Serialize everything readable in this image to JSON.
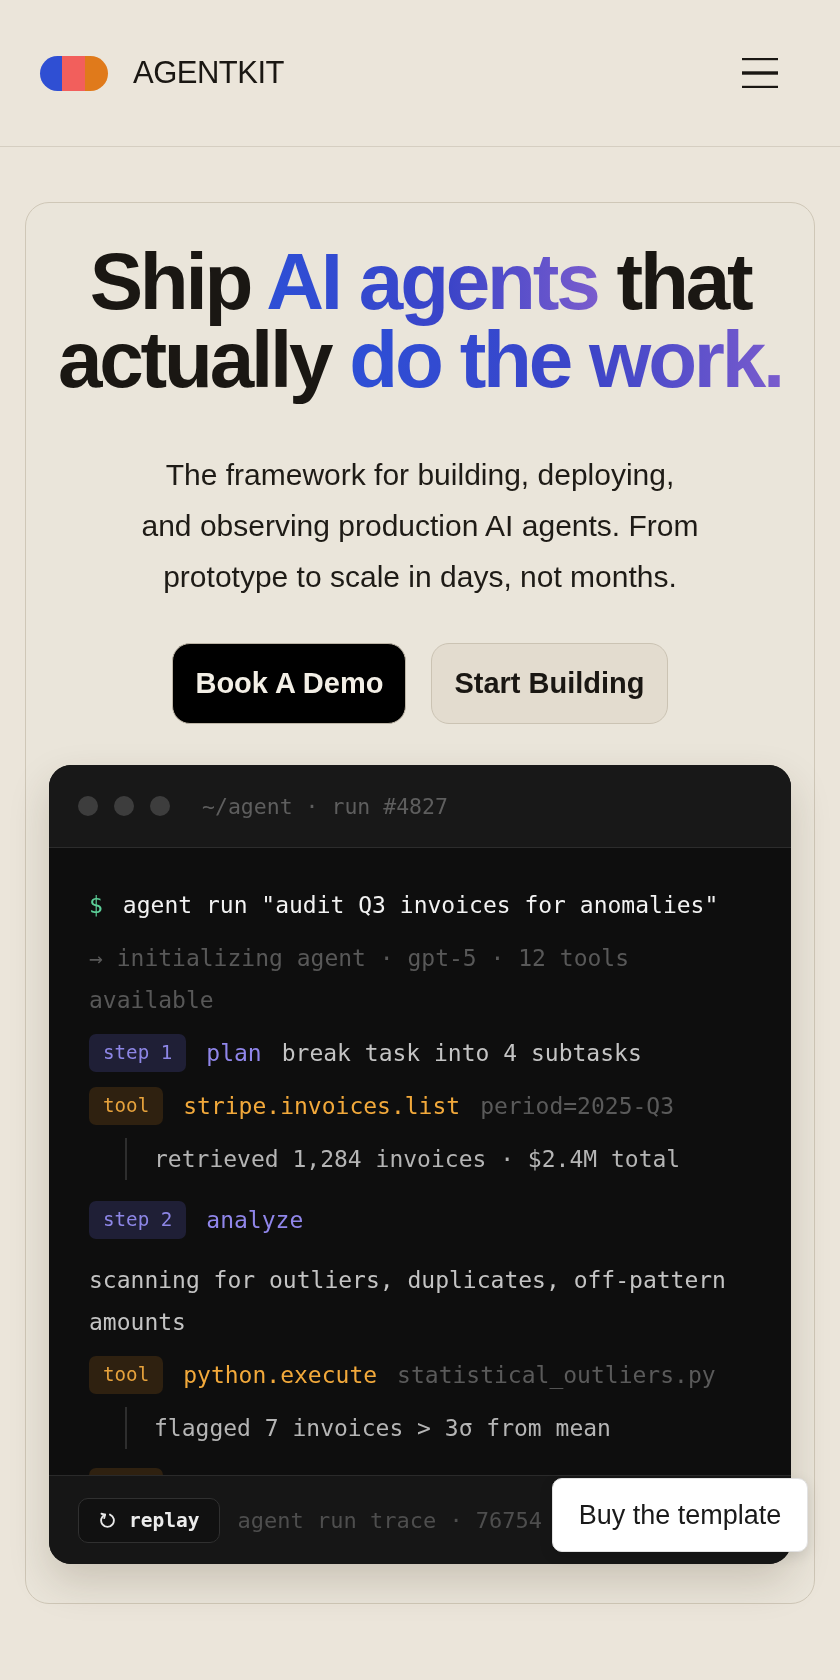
{
  "header": {
    "brand": "AGENTKIT"
  },
  "hero": {
    "headline": [
      {
        "text": "Ship ",
        "highlight": false
      },
      {
        "text": "AI agents",
        "highlight": true
      },
      {
        "text": " that actually ",
        "highlight": false
      },
      {
        "text": "do the work.",
        "highlight": true
      }
    ],
    "subtitle": "The framework for building, deploying, and observing production AI agents. From prototype to scale in days, not months.",
    "buttons": [
      {
        "label": "Book A Demo",
        "kind": "primary"
      },
      {
        "label": "Start Building",
        "kind": "secondary"
      }
    ]
  },
  "terminal": {
    "title": "~/agent · run #4827",
    "lines": [
      {
        "kind": "command",
        "prompt": "$",
        "text": "agent run \"audit Q3 invoices for anomalies\""
      },
      {
        "kind": "info",
        "text": "→ initializing agent · gpt-5 · 12 tools available"
      },
      {
        "kind": "step",
        "badge": "step 1",
        "action": "plan",
        "detail": "break task into 4 subtasks"
      },
      {
        "kind": "tool",
        "badge": "tool",
        "name": "stripe.invoices.list",
        "args": "period=2025-Q3"
      },
      {
        "kind": "output",
        "text": "retrieved 1,284 invoices · $2.4M total"
      },
      {
        "kind": "step",
        "badge": "step 2",
        "action": "analyze",
        "detail": "scanning for outliers, duplicates, off-pattern amounts"
      },
      {
        "kind": "tool",
        "badge": "tool",
        "name": "python.execute",
        "args": "statistical_outliers.py"
      },
      {
        "kind": "output",
        "text": "flagged 7 invoices > 3σ from mean"
      }
    ],
    "footer": {
      "replay": "replay",
      "trace": "agent run trace · 76754"
    }
  },
  "floating_button": {
    "label": "Buy the template"
  }
}
